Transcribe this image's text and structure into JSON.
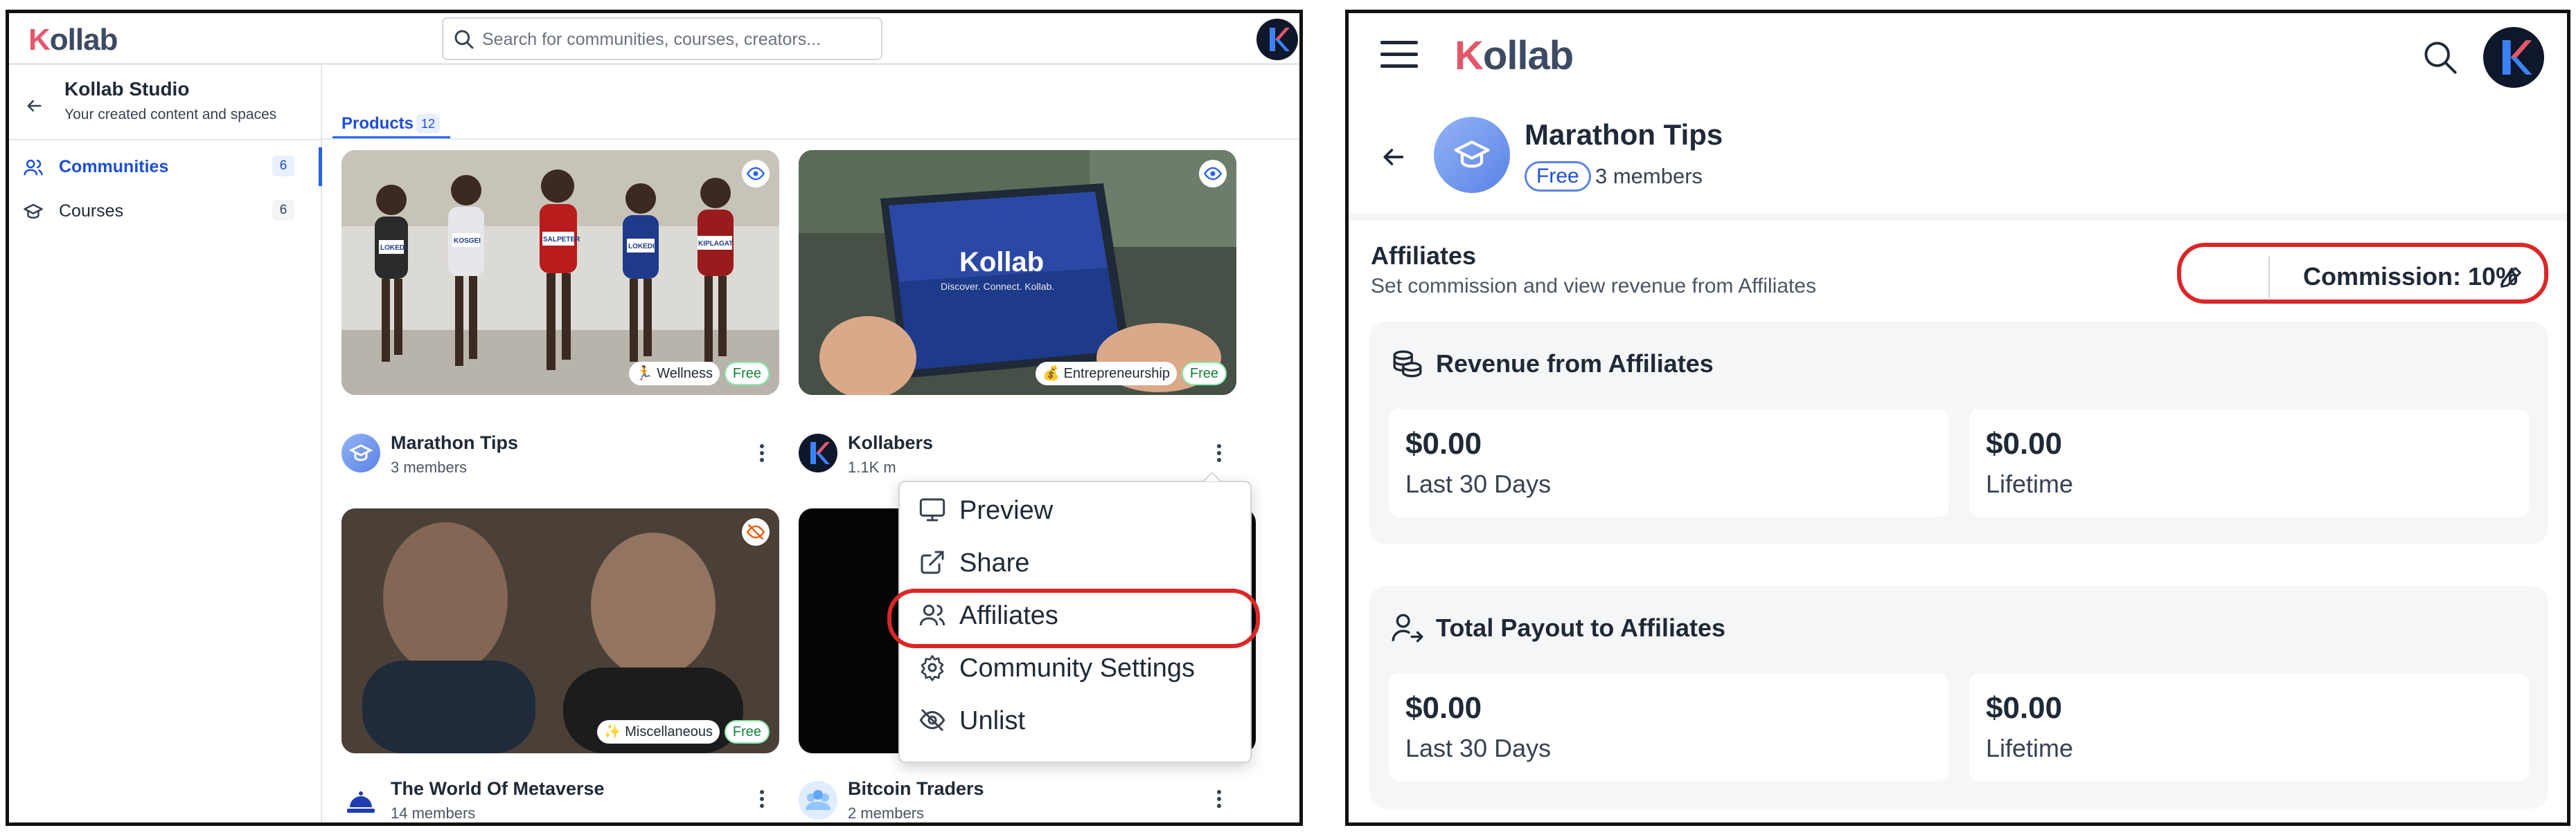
{
  "left": {
    "logo": "Kollab",
    "search_placeholder": "Search for communities, courses, creators...",
    "studio": {
      "title": "Kollab Studio",
      "subtitle": "Your created content and spaces"
    },
    "nav": [
      {
        "label": "Communities",
        "count": "6"
      },
      {
        "label": "Courses",
        "count": "6"
      }
    ],
    "tab": {
      "label": "Products",
      "count": "12"
    },
    "cards": [
      {
        "title": "Marathon Tips",
        "subtitle": "3 members",
        "category": "🏃 Wellness",
        "price": "Free"
      },
      {
        "title": "Kollabers",
        "subtitle": "1.1K m",
        "category": "💰 Entrepreneurship",
        "price": "Free"
      },
      {
        "title": "The World Of Metaverse",
        "subtitle": "14 members",
        "category": "✨ Miscellaneous",
        "price": "Free"
      },
      {
        "title": "Bitcoin Traders",
        "subtitle": "2 members"
      }
    ],
    "tablet_logo": "Kollab",
    "tablet_tagline": "Discover. Connect. Kollab.",
    "runner_bibs": [
      "LOKEDI",
      "KOSGEI",
      "SALPETER",
      "LOKEDI",
      "KIPLAGAT"
    ],
    "menu": [
      {
        "label": "Preview",
        "icon": "monitor-icon"
      },
      {
        "label": "Share",
        "icon": "external-link-icon"
      },
      {
        "label": "Affiliates",
        "icon": "users-icon"
      },
      {
        "label": "Community Settings",
        "icon": "gear-icon"
      },
      {
        "label": "Unlist",
        "icon": "eye-off-icon"
      }
    ],
    "highlighted_item": "Affiliates"
  },
  "right": {
    "logo": "Kollab",
    "product": {
      "title": "Marathon Tips",
      "price": "Free",
      "members": "3 members"
    },
    "affiliates": {
      "title": "Affiliates",
      "subtitle": "Set commission and view revenue from Affiliates",
      "commission": "Commission: 10%"
    },
    "revenue": {
      "title": "Revenue from Affiliates",
      "last30": {
        "value": "$0.00",
        "caption": "Last 30 Days"
      },
      "lifetime": {
        "value": "$0.00",
        "caption": "Lifetime"
      }
    },
    "payout": {
      "title": "Total Payout to Affiliates",
      "last30": {
        "value": "$0.00",
        "caption": "Last 30 Days"
      },
      "lifetime": {
        "value": "$0.00",
        "caption": "Lifetime"
      }
    }
  },
  "colors": {
    "accent": "#2563eb",
    "highlight": "#dc2626",
    "brand_k": "#e4576b",
    "free_green": "#15803d"
  }
}
